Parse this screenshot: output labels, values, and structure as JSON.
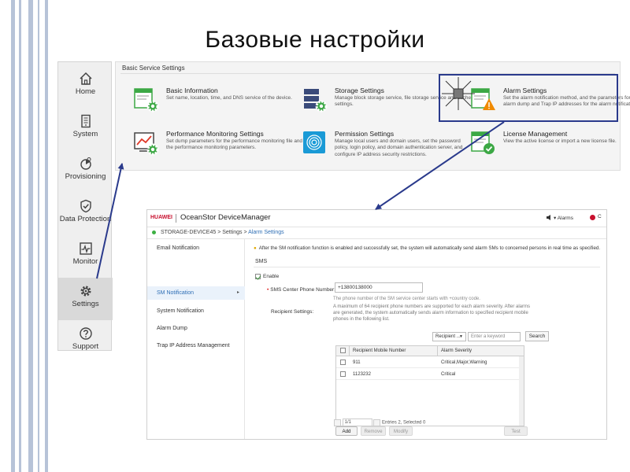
{
  "slide": {
    "title": "Базовые настройки"
  },
  "nav": {
    "items": [
      {
        "label": "Home",
        "icon": "home-icon"
      },
      {
        "label": "System",
        "icon": "system-icon"
      },
      {
        "label": "Provisioning",
        "icon": "provisioning-icon"
      },
      {
        "label": "Data Protection",
        "icon": "shield-check-icon"
      },
      {
        "label": "Monitor",
        "icon": "monitor-icon"
      },
      {
        "label": "Settings",
        "icon": "gear-icon",
        "active": true
      },
      {
        "label": "Support",
        "icon": "question-icon"
      }
    ]
  },
  "services": {
    "title": "Basic Service Settings",
    "tiles": [
      {
        "title": "Basic Information",
        "desc": "Set name, location, time, and DNS service of the device."
      },
      {
        "title": "Storage Settings",
        "desc": "Manage block storage service, file storage service and cache settings."
      },
      {
        "title": "Alarm Settings",
        "desc": "Set the alarm notification method, and the parameters for alarm dump and Trap IP addresses for the alarm notification."
      },
      {
        "title": "Performance Monitoring Settings",
        "desc": "Set dump parameters for the performance monitoring file and the performance monitoring parameters."
      },
      {
        "title": "Permission Settings",
        "desc": "Manage local users and domain users, set the password policy, login policy, and domain authentication server, and configure IP address security restrictions."
      },
      {
        "title": "License Management",
        "desc": "View the active license or import a new license file."
      }
    ]
  },
  "device_manager": {
    "brand": "HUAWEI",
    "app_title": "OceanStor DeviceManager",
    "alarms_label": "Alarms",
    "user_initial": "C",
    "breadcrumb": {
      "device": "STORAGE-DEVICE45",
      "sep1": ">",
      "settings": "Settings",
      "sep2": ">",
      "current": "Alarm Settings"
    },
    "side_menu": [
      "Email Notification",
      "SM Notification",
      "System Notification",
      "Alarm Dump",
      "Trap IP Address Management"
    ],
    "side_active_arrow": "▸",
    "notice": "After the SM notification function is enabled and successfully set, the system will automatically send alarm SMs to concerned persons in real time as specified.",
    "section_title": "SMS",
    "enable_label": "Enable",
    "enable_checked": true,
    "phone_label": "SMS Center Phone Number:",
    "phone_value": "+13800138000",
    "phone_hint": "The phone number of the SM service center starts with +country code.",
    "recipient_label": "Recipient Settings:",
    "recipient_desc": "A maximum of 64 recipient phone numbers are supported for each alarm severity. After alarms are generated, the system automatically sends alarm information to specified recipient mobile phones in the following list.",
    "filter_select": "Recipient ...",
    "keyword_placeholder": "Enter a keyword",
    "search_button": "Search",
    "table": {
      "columns": [
        "Recipient Mobile Number",
        "Alarm Severity"
      ],
      "rows": [
        {
          "number": "911",
          "severity": "Critical,Major,Warning"
        },
        {
          "number": "1123232",
          "severity": "Critical"
        }
      ]
    },
    "pager": {
      "page": "1/1",
      "summary": "Entries 2, Selected 0"
    },
    "buttons": {
      "add": "Add",
      "remove": "Remove",
      "modify": "Modify",
      "test": "Test"
    }
  }
}
